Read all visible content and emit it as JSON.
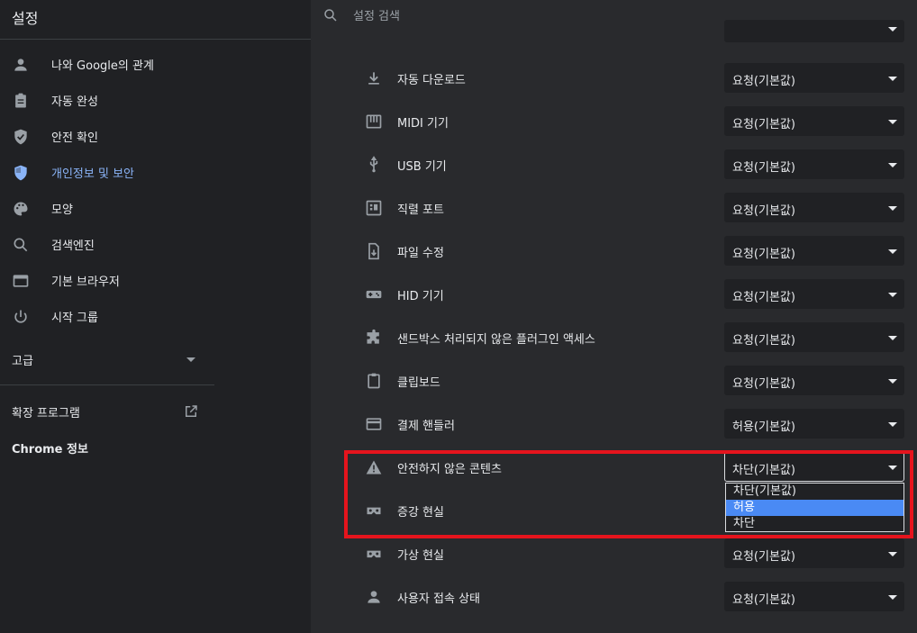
{
  "header": {
    "title": "설정",
    "search_placeholder": "설정 검색"
  },
  "sidebar": {
    "items": [
      {
        "label": "나와 Google의 관계",
        "icon": "person-icon"
      },
      {
        "label": "자동 완성",
        "icon": "clipboard-icon"
      },
      {
        "label": "안전 확인",
        "icon": "shield-check-icon"
      },
      {
        "label": "개인정보 및 보안",
        "icon": "shield-privacy-icon"
      },
      {
        "label": "모양",
        "icon": "palette-icon"
      },
      {
        "label": "검색엔진",
        "icon": "search-icon"
      },
      {
        "label": "기본 브라우저",
        "icon": "browser-window-icon"
      },
      {
        "label": "시작 그룹",
        "icon": "power-icon"
      }
    ],
    "advanced_label": "고급",
    "extensions_label": "확장 프로그램",
    "about_label": "Chrome 정보"
  },
  "permissions": [
    {
      "label": "자동 다운로드",
      "icon": "download-icon",
      "value": "요청(기본값)"
    },
    {
      "label": "MIDI 기기",
      "icon": "piano-icon",
      "value": "요청(기본값)"
    },
    {
      "label": "USB 기기",
      "icon": "usb-icon",
      "value": "요청(기본값)"
    },
    {
      "label": "직렬 포트",
      "icon": "serial-port-icon",
      "value": "요청(기본값)"
    },
    {
      "label": "파일 수정",
      "icon": "file-download-icon",
      "value": "요청(기본값)"
    },
    {
      "label": "HID 기기",
      "icon": "gamepad-icon",
      "value": "요청(기본값)"
    },
    {
      "label": "샌드박스 처리되지 않은 플러그인 액세스",
      "icon": "puzzle-icon",
      "value": "요청(기본값)"
    },
    {
      "label": "클립보드",
      "icon": "clipboard-icon",
      "value": "요청(기본값)"
    },
    {
      "label": "결제 핸들러",
      "icon": "credit-card-icon",
      "value": "허용(기본값)"
    },
    {
      "label": "안전하지 않은 콘텐츠",
      "icon": "warning-icon",
      "value": "차단(기본값)"
    },
    {
      "label": "증강 현실",
      "icon": "vr-headset-icon",
      "value": ""
    },
    {
      "label": "가상 현실",
      "icon": "vr-headset-icon",
      "value": "요청(기본값)"
    },
    {
      "label": "사용자 접속 상태",
      "icon": "person-icon",
      "value": "요청(기본값)"
    }
  ],
  "dropdown": {
    "options": [
      "차단(기본값)",
      "허용",
      "차단"
    ],
    "selected_index": 1
  },
  "colors": {
    "accent": "#8ab4f8",
    "highlight": "#e5141d",
    "selected_option": "#4a8af4"
  }
}
